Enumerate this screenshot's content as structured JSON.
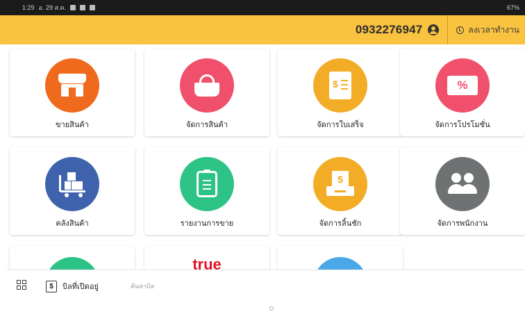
{
  "status_bar": {
    "time": "1:29",
    "date": "อ. 29 ส.ค.",
    "battery": "67%"
  },
  "app_bar": {
    "phone": "0932276947",
    "clock_in_label": "ลงเวลาทำงาน"
  },
  "colors": {
    "appbar": "#f9c23f",
    "store": "#f06a1d",
    "products": "#f0506c",
    "receipt": "#f3ac26",
    "promo": "#f0506c",
    "warehouse": "#3f62ad",
    "report": "#2dc387",
    "drawer": "#f3ac26",
    "staff": "#6e7273"
  },
  "menu": [
    {
      "label": "ขายสินค้า",
      "icon": "store-icon"
    },
    {
      "label": "จัดการสินค้า",
      "icon": "basket-icon"
    },
    {
      "label": "จัดการใบเสร็จ",
      "icon": "receipt-icon"
    },
    {
      "label": "จัดการโปรโมชั่น",
      "icon": "coupon-icon"
    },
    {
      "label": "คลังสินค้า",
      "icon": "warehouse-cart-icon"
    },
    {
      "label": "รายงานการขาย",
      "icon": "clipboard-icon"
    },
    {
      "label": "จัดการลิ้นชัก",
      "icon": "cash-drawer-icon"
    },
    {
      "label": "จัดการพนักงาน",
      "icon": "staff-icon"
    }
  ],
  "partial_row": {
    "logo_text": "true"
  },
  "bottom_bar": {
    "bill_label": "บิลที่เปิดอยู่",
    "search_placeholder": "ค้นหาบิล"
  }
}
